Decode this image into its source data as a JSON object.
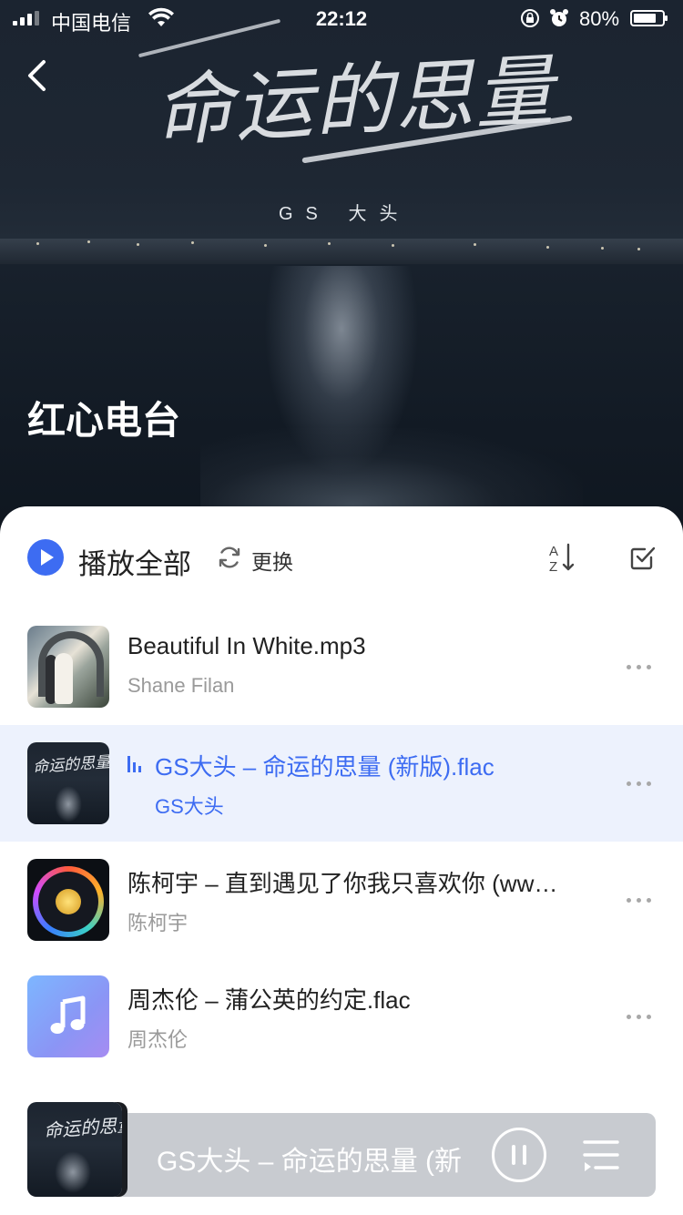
{
  "status_bar": {
    "carrier": "中国电信",
    "time": "22:12",
    "battery": "80%",
    "battery_level": 0.8
  },
  "cover": {
    "art_title": "命运的思量",
    "art_artist": "GS 大头",
    "playlist_title": "红心电台"
  },
  "toolbar": {
    "play_all_label": "播放全部",
    "refresh_label": "更换"
  },
  "songs": [
    {
      "title": "Beautiful In White.mp3",
      "artist": "Shane Filan",
      "active": false,
      "thumb": "wedding-photo"
    },
    {
      "title": "GS大头 – 命运的思量 (新版).flac",
      "artist": "GS大头",
      "active": true,
      "thumb": "album-cover-night-sea"
    },
    {
      "title": "陈柯宇 – 直到遇见了你我只喜欢你 (ww…",
      "artist": "陈柯宇",
      "active": false,
      "thumb": "vinyl-disc"
    },
    {
      "title": "周杰伦 – 蒲公英的约定.flac",
      "artist": "周杰伦",
      "active": false,
      "thumb": "music-note"
    }
  ],
  "mini_player": {
    "title": "GS大头 – 命运的思量 (新",
    "cover_text": "命运的思量"
  },
  "colors": {
    "accent": "#3d6cf2",
    "active_row_bg": "#edf2fd",
    "mini_player_bg": "#c8cbd0"
  }
}
